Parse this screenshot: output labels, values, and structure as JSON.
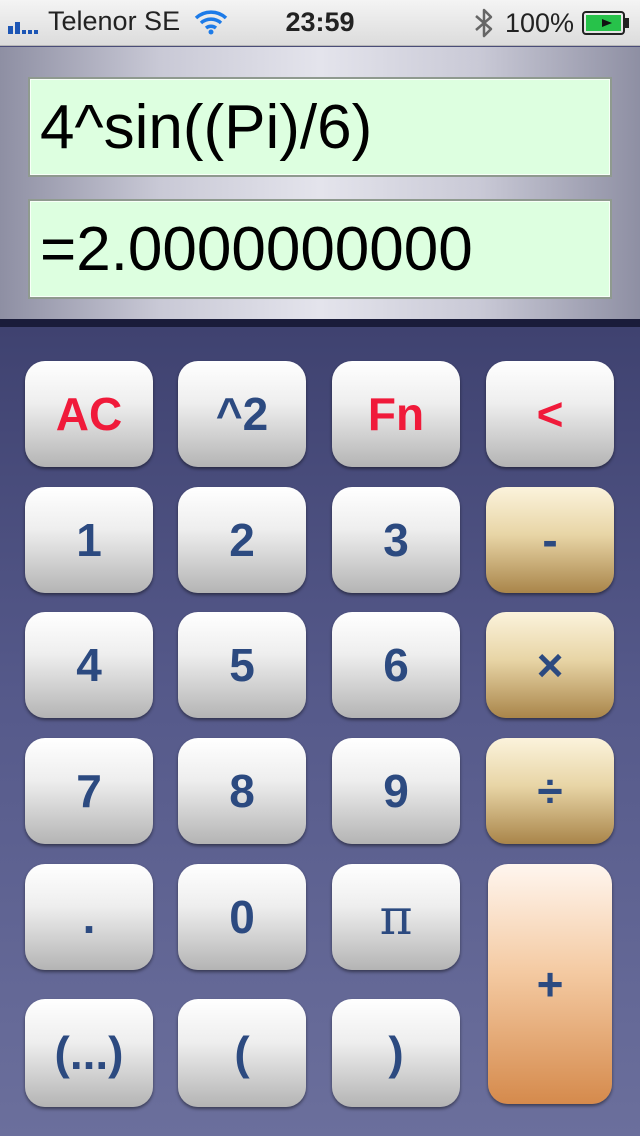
{
  "status_bar": {
    "carrier": "Telenor SE",
    "time": "23:59",
    "battery": "100%"
  },
  "display": {
    "expression": "4^sin((Pi)/6)",
    "result": "=2.0000000000"
  },
  "keys": {
    "ac": "AC",
    "square": "^2",
    "fn": "Fn",
    "back": "<",
    "one": "1",
    "two": "2",
    "three": "3",
    "minus": "-",
    "four": "4",
    "five": "5",
    "six": "6",
    "multiply": "×",
    "seven": "7",
    "eight": "8",
    "nine": "9",
    "divide": "÷",
    "dot": ".",
    "zero": "0",
    "pi": "π",
    "plus": "+",
    "group": "(...)",
    "open_paren": "(",
    "close_paren": ")"
  },
  "colors": {
    "key_text": "#2c4a80",
    "key_text_red": "#f01a3a",
    "display_bg": "#ddffe0",
    "keypad_bg": "#4a4d78"
  }
}
